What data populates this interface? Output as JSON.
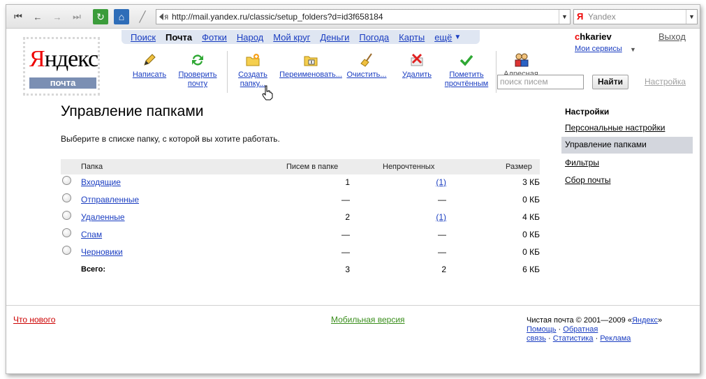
{
  "browser": {
    "url": "http://mail.yandex.ru/classic/setup_folders?d=id3f658184",
    "search_engine": "Yandex",
    "search_engine_logo": "Я"
  },
  "logo": {
    "main_first": "Я",
    "main_rest": "ндекс",
    "sub": "почта"
  },
  "services": {
    "items": [
      "Поиск",
      "Почта",
      "Фотки",
      "Народ",
      "Мой круг",
      "Деньги",
      "Погода",
      "Карты"
    ],
    "active": "Почта",
    "more": "ещё"
  },
  "user": {
    "first_letter": "c",
    "rest": "hkariev",
    "my_services": "Мои сервисы",
    "logout": "Выход"
  },
  "toolbar": {
    "write": [
      "Написать"
    ],
    "check": [
      "Проверить",
      "почту"
    ],
    "create": [
      "Создать",
      "папку..."
    ],
    "rename": [
      "Переименовать..."
    ],
    "clear": [
      "Очистить..."
    ],
    "delete": [
      "Удалить"
    ],
    "mark_read": [
      "Пометить",
      "прочтённым"
    ],
    "addresses": [
      "Адресная"
    ],
    "search_placeholder": "поиск писем",
    "find": "Найти",
    "settings": "Настройка"
  },
  "main": {
    "title": "Управление папками",
    "hint": "Выберите в списке папку, с которой вы хотите работать.",
    "columns": {
      "folder": "Папка",
      "count": "Писем в папке",
      "unread": "Непрочтенных",
      "size": "Размер"
    },
    "rows": [
      {
        "name": "Входящие",
        "count": "1",
        "unread": "(1)",
        "unread_link": true,
        "size": "3 КБ"
      },
      {
        "name": "Отправленные",
        "count": "—",
        "unread": "—",
        "unread_link": false,
        "size": "0 КБ"
      },
      {
        "name": "Удаленные",
        "count": "2",
        "unread": "(1)",
        "unread_link": true,
        "size": "4 КБ"
      },
      {
        "name": "Спам",
        "count": "—",
        "unread": "—",
        "unread_link": false,
        "size": "0 КБ"
      },
      {
        "name": "Черновики",
        "count": "—",
        "unread": "—",
        "unread_link": false,
        "size": "0 КБ"
      }
    ],
    "total": {
      "label": "Всего:",
      "count": "3",
      "unread": "2",
      "size": "6 КБ"
    }
  },
  "sidebar": {
    "title": "Настройки",
    "items": [
      "Персональные настройки",
      "Управление папками",
      "Фильтры",
      "Сбор почты"
    ],
    "active": "Управление папками"
  },
  "footer": {
    "whats_new": "Что нового",
    "mobile": "Мобильная версия",
    "copyright": "Чистая почта © 2001—2009 «",
    "yandex": "Яндекс",
    "copyright_end": "»",
    "help": "Помощь",
    "feedback1": "Обратная",
    "feedback2": "связь",
    "stats": "Статистика",
    "ads": "Реклама"
  }
}
